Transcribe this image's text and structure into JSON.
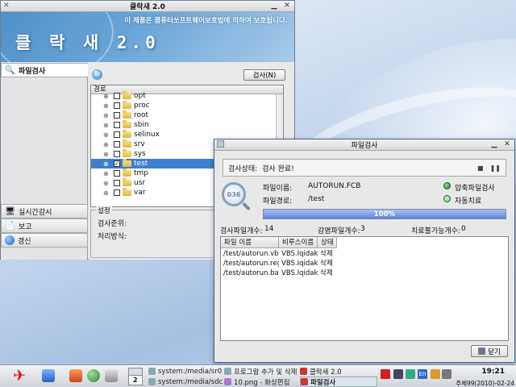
{
  "main_window": {
    "title": "클락새 2.0",
    "banner_notice": "이 제품은 콤퓨터쏘프트웨어보호법에 의하여 보호됩니다.",
    "banner_logo": "클 락 새 2.0",
    "sidebar": [
      {
        "label": "파일검사",
        "icon": "magnifier-icon"
      },
      {
        "label": "실시간감시",
        "icon": "monitor-icon"
      },
      {
        "label": "보고",
        "icon": "report-icon"
      },
      {
        "label": "갱신",
        "icon": "globe-icon"
      }
    ],
    "search_button": "검사(N)",
    "tree_header": "경로",
    "tree_items": [
      {
        "name": "opt",
        "checked": false,
        "selected": false
      },
      {
        "name": "proc",
        "checked": false,
        "selected": false
      },
      {
        "name": "root",
        "checked": false,
        "selected": false
      },
      {
        "name": "sbin",
        "checked": false,
        "selected": false
      },
      {
        "name": "selinux",
        "checked": false,
        "selected": false
      },
      {
        "name": "srv",
        "checked": false,
        "selected": false
      },
      {
        "name": "sys",
        "checked": false,
        "selected": false
      },
      {
        "name": "test",
        "checked": true,
        "selected": true
      },
      {
        "name": "tmp",
        "checked": false,
        "selected": false
      },
      {
        "name": "usr",
        "checked": false,
        "selected": false
      },
      {
        "name": "var",
        "checked": false,
        "selected": false
      }
    ],
    "settings_legend": "설정",
    "settings_rows": [
      "검사준위:",
      "처리방식:"
    ]
  },
  "dialog": {
    "title": "파일검사",
    "status_label": "검사상태:",
    "status_value": "검사 완료!",
    "file_name_label": "파일이름:",
    "file_name_value": "AUTORUN.FCB",
    "file_path_label": "파일경로:",
    "file_path_value": "/test",
    "option_compressed": "압축파일검사",
    "option_auto": "자동치료",
    "progress_text": "100%",
    "progress_value": 1.0,
    "count_scanned_label": "검사파일개수:",
    "count_scanned_value": "14",
    "count_infected_label": "감염파일개수:",
    "count_infected_value": "3",
    "count_unhealable_label": "치료불가능개수:",
    "count_unhealable_value": "0",
    "columns": [
      "파일 이름",
      "비루스이름",
      "상태"
    ],
    "rows": [
      [
        "/test/autorun.vbs",
        "VBS.Iqidak",
        "삭제"
      ],
      [
        "/test/autorun.reg",
        "VBS.Iqidak",
        "삭제"
      ],
      [
        "/test/autorun.bat",
        "VBS.Iqidak",
        "삭제"
      ]
    ],
    "close_button": "닫기",
    "colors": {
      "green_dot": "#2f9a32",
      "progress": "#5d86dd"
    }
  },
  "taskbar": {
    "pager_label": "2",
    "tasks": [
      {
        "label": "system:/media/sr0"
      },
      {
        "label": "프로그람 추가 및 삭제"
      },
      {
        "label": "클락새 2.0"
      },
      {
        "label": "system:/media/sdc"
      },
      {
        "label": "10.png - 화상편집"
      },
      {
        "label": "파일검사"
      }
    ],
    "tray_lang": "En",
    "clock": "19:21",
    "date": "주체99(2010)-02-24"
  }
}
